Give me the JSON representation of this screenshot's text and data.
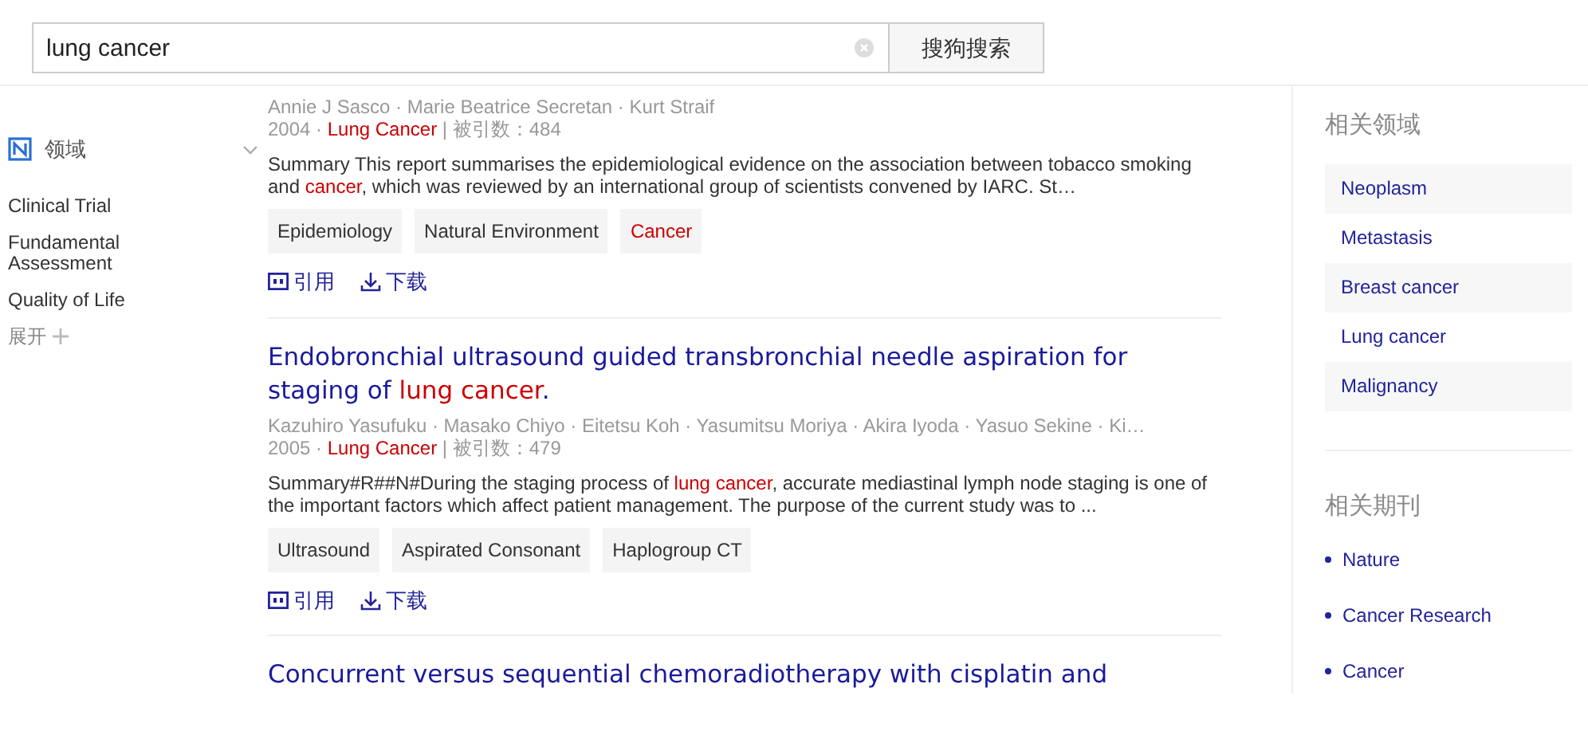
{
  "search": {
    "value": "lung cancer",
    "button": "搜狗搜索"
  },
  "sidebar": {
    "heading": "领域",
    "items": [
      "Clinical Trial",
      "Fundamental Assessment",
      "Quality of Life"
    ],
    "more": "展开"
  },
  "results": [
    {
      "authors": "Annie J Sasco · Marie Beatrice Secretan · Kurt Straif",
      "meta": [
        {
          "text": "2004 · "
        },
        {
          "text": "Lung Cancer",
          "highlight": true
        },
        {
          "text": "  |  被引数：484"
        }
      ],
      "summary": [
        {
          "text": "Summary This report summarises the epidemiological evidence on the association between tobacco smoking and "
        },
        {
          "text": "cancer",
          "highlight": true
        },
        {
          "text": ", which was reviewed by an international group of scientists convened by IARC. St…"
        }
      ],
      "tags": [
        {
          "label": "Epidemiology",
          "highlight": false
        },
        {
          "label": "Natural Environment",
          "highlight": false
        },
        {
          "label": "Cancer",
          "highlight": true
        }
      ],
      "actions": [
        {
          "kind": "cite",
          "label": "引用"
        },
        {
          "kind": "download",
          "label": "下载"
        }
      ]
    },
    {
      "title": [
        {
          "text": "Endobronchial ultrasound guided transbronchial needle aspiration for staging of "
        },
        {
          "text": "lung cancer",
          "highlight": true
        },
        {
          "text": "."
        }
      ],
      "authors": "Kazuhiro Yasufuku · Masako Chiyo · Eitetsu Koh · Yasumitsu Moriya · Akira Iyoda · Yasuo Sekine · Ki…",
      "meta": [
        {
          "text": "2005 · "
        },
        {
          "text": "Lung Cancer",
          "highlight": true
        },
        {
          "text": "  |  被引数：479"
        }
      ],
      "summary": [
        {
          "text": "Summary#R##N#During the staging process of "
        },
        {
          "text": "lung cancer",
          "highlight": true
        },
        {
          "text": ", accurate mediastinal lymph node staging is one of the important factors which affect patient management. The purpose of the current study was to ..."
        }
      ],
      "tags": [
        {
          "label": "Ultrasound",
          "highlight": false
        },
        {
          "label": "Aspirated Consonant",
          "highlight": false
        },
        {
          "label": "Haplogroup CT",
          "highlight": false
        }
      ],
      "actions": [
        {
          "kind": "cite",
          "label": "引用"
        },
        {
          "kind": "download",
          "label": "下载"
        }
      ]
    },
    {
      "title": [
        {
          "text": "Concurrent versus sequential chemoradiotherapy with cisplatin and"
        }
      ]
    }
  ],
  "related_fields": {
    "heading": "相关领域",
    "items": [
      "Neoplasm",
      "Metastasis",
      "Breast cancer",
      "Lung cancer",
      "Malignancy"
    ]
  },
  "related_journals": {
    "heading": "相关期刊",
    "items": [
      "Nature",
      "Cancer Research",
      "Cancer"
    ]
  }
}
